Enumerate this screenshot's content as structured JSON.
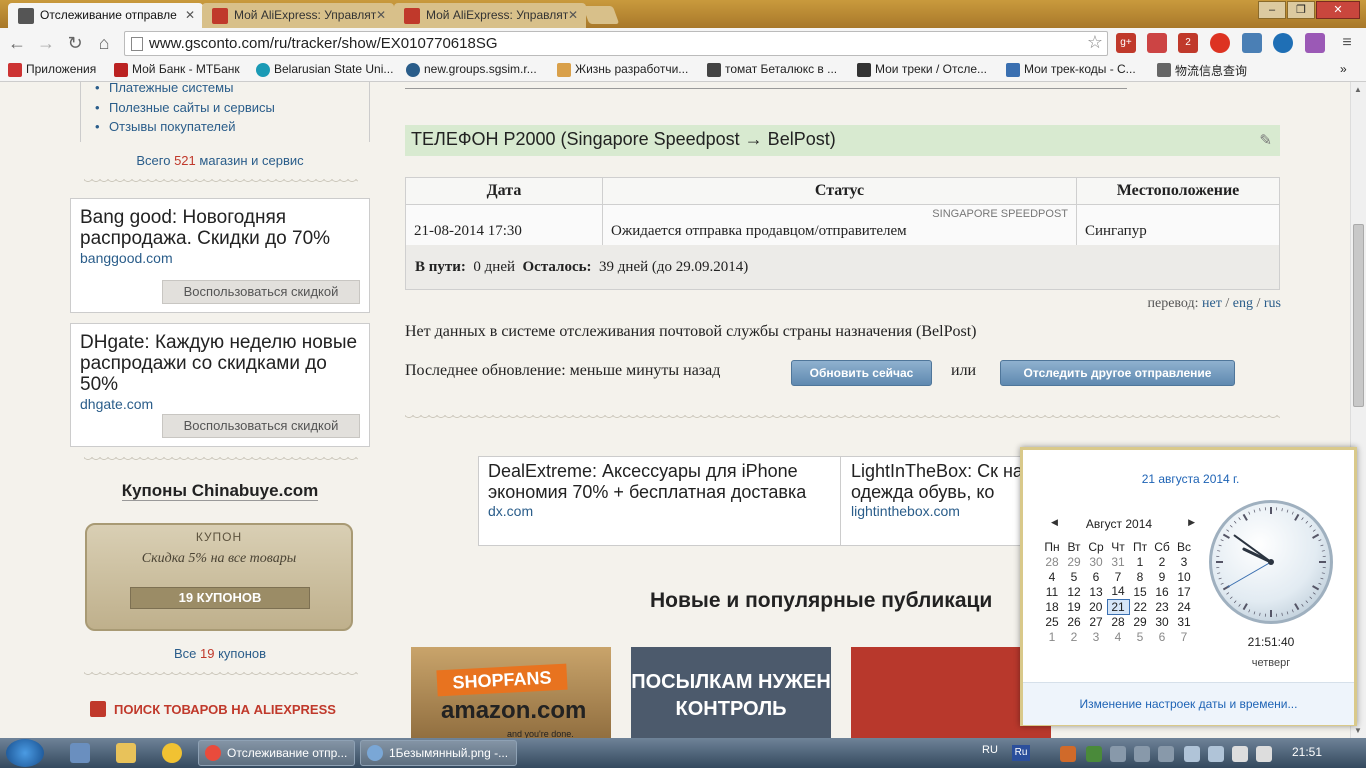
{
  "browser": {
    "tabs": [
      {
        "label": "Отслеживание отправле",
        "active": true,
        "icon": "gsconto-icon"
      },
      {
        "label": "Мой AliExpress: Управлят",
        "active": false,
        "icon": "aliexpress-icon"
      },
      {
        "label": "Мой AliExpress: Управлят",
        "active": false,
        "icon": "aliexpress-icon"
      }
    ],
    "url": "www.gsconto.com/ru/tracker/show/EX010770618SG",
    "extension_badge": "2",
    "bookmarks": [
      "Приложения",
      "Мой Банк - МТБанк",
      "Belarusian State Uni...",
      "new.groups.sgsim.r...",
      "Жизнь разработчи...",
      "томат Беталюкс в ...",
      "Мои треки / Отсле...",
      "Мои трек-коды - С...",
      "物流信息查询"
    ]
  },
  "sidebar": {
    "links": [
      "Платежные системы",
      "Полезные сайты и сервисы",
      "Отзывы покупателей"
    ],
    "total_prefix": "Всего",
    "total_count": "521",
    "total_suffix": "магазин и сервис",
    "promos": [
      {
        "title": "Bang good: Новогодняя распродажа. Скидки до 70%",
        "link": "banggood.com",
        "button": "Воспользоваться скидкой"
      },
      {
        "title": "DHgate: Каждую неделю новые распродажи со скидками до 50%",
        "link": "dhgate.com",
        "button": "Воспользоваться скидкой"
      }
    ],
    "coupons_title": "Купоны Chinabuye.com",
    "coupon_tag": "КУПОН",
    "coupon_text": "Скидка 5% на все товары",
    "coupon_button": "19 КУПОНОВ",
    "all_coupons_prefix": "Все",
    "all_coupons_count": "19",
    "all_coupons_suffix": "купонов",
    "aliexpress_search": "ПОИСК ТОВАРОВ НА ALIEXPRESS"
  },
  "parcel": {
    "title": "ТЕЛЕФОН P2000 (Singapore Speedpost → BelPost)",
    "columns": [
      "Дата",
      "Статус",
      "Местоположение"
    ],
    "rows": [
      {
        "date": "21-08-2014 17:30",
        "carrier": "SINGAPORE SPEEDPOST",
        "status": "Ожидается отправка продавцом/отправителем",
        "location": "Сингапур"
      }
    ],
    "in_transit_label": "В пути:",
    "in_transit_value": "0 дней",
    "remaining_label": "Осталось:",
    "remaining_value": "39 дней (до 29.09.2014)",
    "translate_label": "перевод:",
    "translate_options": [
      "нет",
      "eng",
      "rus"
    ],
    "no_data_text": "Нет данных в системе отслеживания почтовой службы страны назначения (BelPost)",
    "last_update": "Последнее обновление: меньше минуты назад",
    "refresh_button": "Обновить сейчас",
    "or_text": "или",
    "track_other_button": "Отследить другое отправление"
  },
  "ads": [
    {
      "title": "DealExtreme: Аксессуары для iPhone экономия 70% + бесплатная доставка",
      "link": "dx.com"
    },
    {
      "title": "LightInTheBox: Ск на весь ассортим одежда обувь, ко",
      "link": "lightinthebox.com"
    }
  ],
  "news_title": "Новые и популярные публикаци",
  "thumbnails": [
    {
      "text": "SHOPFANS",
      "sub": "amazon.com",
      "tagline": "and you're done."
    },
    {
      "text": "ПОСЫЛКАМ НУЖЕН КОНТРОЛЬ"
    },
    {
      "text": ""
    }
  ],
  "calendar": {
    "date_title": "21 августа 2014 г.",
    "month": "Август 2014",
    "weekdays": [
      "Пн",
      "Вт",
      "Ср",
      "Чт",
      "Пт",
      "Сб",
      "Вс"
    ],
    "weeks": [
      [
        "28",
        "29",
        "30",
        "31",
        "1",
        "2",
        "3"
      ],
      [
        "4",
        "5",
        "6",
        "7",
        "8",
        "9",
        "10"
      ],
      [
        "11",
        "12",
        "13",
        "14",
        "15",
        "16",
        "17"
      ],
      [
        "18",
        "19",
        "20",
        "21",
        "22",
        "23",
        "24"
      ],
      [
        "25",
        "26",
        "27",
        "28",
        "29",
        "30",
        "31"
      ],
      [
        "1",
        "2",
        "3",
        "4",
        "5",
        "6",
        "7"
      ]
    ],
    "today": "21",
    "time": "21:51:40",
    "weekday_name": "четверг",
    "settings_link": "Изменение настроек даты и времени...",
    "clock_hours": 9,
    "clock_minutes": 51,
    "clock_seconds": 40
  },
  "taskbar": {
    "tasks": [
      "Отслеживание отпр...",
      "1Безымянный.png -..."
    ],
    "lang": "RU",
    "ime": "Ru",
    "time": "21:51"
  }
}
